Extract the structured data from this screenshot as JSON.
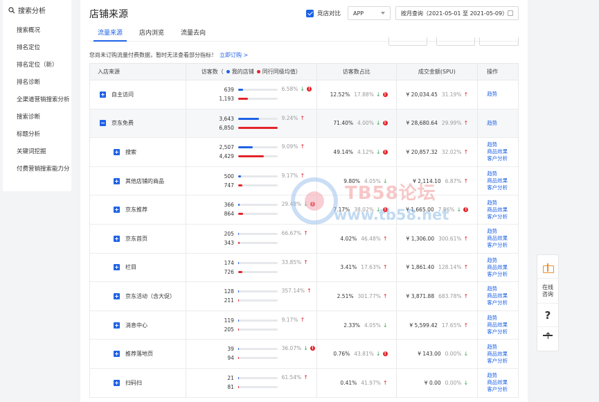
{
  "sidebar": {
    "header": "搜索分析",
    "items": [
      "搜索概况",
      "排名定位",
      "排名定位（新）",
      "排名诊断",
      "全渠道营销搜索分析",
      "搜索诊断",
      "标题分析",
      "关键词挖掘",
      "付费营销搜索能力分"
    ]
  },
  "page": {
    "title": "店铺来源",
    "compare_label": "竞店对比",
    "platform": "APP",
    "date_range": "按月查询（2021-05-01 至 2021-05-09）",
    "tabs": [
      "流量来源",
      "店内浏览",
      "流量去向"
    ],
    "notice": "您尚未订购流量付费数据，暂时无法查看部分指标！",
    "notice_link": "立即订购 >"
  },
  "table": {
    "headers": {
      "source": "入店来源",
      "visitors": "访客数（",
      "legend_mine": "我的店铺",
      "legend_peer": "同行同级均值）",
      "ratio": "访客数占比",
      "amount": "成交金额(SPU)",
      "op": "操作"
    },
    "colors": {
      "mine": "#1e62e6",
      "peer": "#e3242b",
      "up": "#e3242b",
      "down": "#35a854"
    },
    "rows": [
      {
        "name": "自主访问",
        "level": 0,
        "expand": "plus",
        "v1": "639",
        "v2": "1,193",
        "f1": 0.13,
        "f2": 0.25,
        "pct": "6.58%",
        "pct_dir": "down",
        "pct_warn": true,
        "ratio": "12.52%",
        "ratio2": "17.88%",
        "ratio_dir": "down",
        "ratio_warn": true,
        "amt": "¥ 20,034.45",
        "amt2": "31.19%",
        "amt_dir": "up",
        "amt_warn": false,
        "ops": [
          "趋势"
        ]
      },
      {
        "name": "京东免费",
        "level": 0,
        "expand": "minus",
        "hl": true,
        "v1": "3,643",
        "v2": "6,850",
        "f1": 0.53,
        "f2": 1.0,
        "pct": "9.24%",
        "pct_dir": "up",
        "pct_warn": false,
        "ratio": "71.40%",
        "ratio2": "4.00%",
        "ratio_dir": "down",
        "ratio_warn": true,
        "amt": "¥ 28,680.64",
        "amt2": "29.99%",
        "amt_dir": "up",
        "amt_warn": false,
        "ops": [
          "趋势"
        ]
      },
      {
        "name": "搜索",
        "level": 1,
        "expand": "plus",
        "v1": "2,507",
        "v2": "4,429",
        "f1": 0.37,
        "f2": 0.65,
        "pct": "9.09%",
        "pct_dir": "up",
        "pct_warn": false,
        "ratio": "49.14%",
        "ratio2": "4.12%",
        "ratio_dir": "down",
        "ratio_warn": true,
        "amt": "¥ 20,857.32",
        "amt2": "32.02%",
        "amt_dir": "up",
        "amt_warn": false,
        "ops": [
          "趋势",
          "商品效果",
          "客户分析"
        ]
      },
      {
        "name": "其他店铺的商品",
        "level": 1,
        "expand": "plus",
        "v1": "500",
        "v2": "747",
        "f1": 0.07,
        "f2": 0.11,
        "pct": "9.17%",
        "pct_dir": "up",
        "pct_warn": false,
        "ratio": "9.80%",
        "ratio2": "4.05%",
        "ratio_dir": "down",
        "ratio_warn": false,
        "amt": "¥ 2,114.10",
        "amt2": "6.87%",
        "amt_dir": "up",
        "amt_warn": false,
        "ops": [
          "趋势",
          "商品效果",
          "客户分析"
        ]
      },
      {
        "name": "京东推荐",
        "level": 1,
        "expand": "plus",
        "v1": "366",
        "v2": "864",
        "f1": 0.05,
        "f2": 0.13,
        "pct": "29.48%",
        "pct_dir": "down",
        "pct_warn": true,
        "ratio": "7.17%",
        "ratio2": "38.02%",
        "ratio_dir": "down",
        "ratio_warn": true,
        "amt": "¥ 1,665.00",
        "amt2": "7.86%",
        "amt_dir": "down",
        "amt_warn": true,
        "ops": [
          "趋势",
          "商品效果",
          "客户分析"
        ]
      },
      {
        "name": "京东首页",
        "level": 1,
        "expand": "plus",
        "v1": "205",
        "v2": "343",
        "f1": 0.03,
        "f2": 0.05,
        "pct": "66.67%",
        "pct_dir": "up",
        "pct_warn": false,
        "ratio": "4.02%",
        "ratio2": "46.48%",
        "ratio_dir": "up",
        "ratio_warn": false,
        "amt": "¥ 1,306.00",
        "amt2": "300.61%",
        "amt_dir": "up",
        "amt_warn": false,
        "ops": [
          "趋势",
          "商品效果",
          "客户分析"
        ]
      },
      {
        "name": "栏目",
        "level": 1,
        "expand": "plus",
        "v1": "174",
        "v2": "726",
        "f1": 0.03,
        "f2": 0.11,
        "pct": "33.85%",
        "pct_dir": "up",
        "pct_warn": false,
        "ratio": "3.41%",
        "ratio2": "17.63%",
        "ratio_dir": "up",
        "ratio_warn": false,
        "amt": "¥ 1,861.40",
        "amt2": "128.14%",
        "amt_dir": "up",
        "amt_warn": false,
        "ops": [
          "趋势",
          "商品效果",
          "客户分析"
        ]
      },
      {
        "name": "京东活动（含大促）",
        "level": 1,
        "expand": "plus",
        "v1": "128",
        "v2": "211",
        "f1": 0.02,
        "f2": 0.03,
        "pct": "357.14%",
        "pct_dir": "up",
        "pct_warn": false,
        "ratio": "2.51%",
        "ratio2": "301.77%",
        "ratio_dir": "up",
        "ratio_warn": false,
        "amt": "¥ 3,871.88",
        "amt2": "683.78%",
        "amt_dir": "up",
        "amt_warn": false,
        "ops": [
          "趋势",
          "商品效果",
          "客户分析"
        ]
      },
      {
        "name": "消息中心",
        "level": 1,
        "expand": "plus",
        "v1": "119",
        "v2": "205",
        "f1": 0.02,
        "f2": 0.03,
        "pct": "9.17%",
        "pct_dir": "up",
        "pct_warn": false,
        "ratio": "2.33%",
        "ratio2": "4.05%",
        "ratio_dir": "down",
        "ratio_warn": false,
        "amt": "¥ 5,599.42",
        "amt2": "17.65%",
        "amt_dir": "up",
        "amt_warn": false,
        "ops": [
          "趋势",
          "商品效果",
          "客户分析"
        ]
      },
      {
        "name": "推荐落地页",
        "level": 1,
        "expand": "plus",
        "v1": "39",
        "v2": "94",
        "f1": 0.006,
        "f2": 0.014,
        "pct": "36.07%",
        "pct_dir": "down",
        "pct_warn": true,
        "ratio": "0.76%",
        "ratio2": "43.81%",
        "ratio_dir": "down",
        "ratio_warn": true,
        "amt": "¥ 143.00",
        "amt2": "0.00%",
        "amt_dir": "down",
        "amt_warn": false,
        "ops": [
          "趋势",
          "商品效果",
          "客户分析"
        ]
      },
      {
        "name": "扫码扫",
        "level": 1,
        "expand": "plus",
        "v1": "21",
        "v2": "81",
        "f1": 0.003,
        "f2": 0.012,
        "pct": "61.54%",
        "pct_dir": "up",
        "pct_warn": false,
        "ratio": "0.41%",
        "ratio2": "41.97%",
        "ratio_dir": "up",
        "ratio_warn": false,
        "amt": "¥ 0.00",
        "amt2": "0.00%",
        "amt_dir": "down",
        "amt_warn": false,
        "ops": [
          "趋势",
          "商品效果",
          "客户分析"
        ]
      }
    ]
  },
  "watermark": {
    "line1": "TB58论坛",
    "line2": "www.tb58.net"
  },
  "float_tools": {
    "consult": "在线咨询",
    "help": "?"
  }
}
